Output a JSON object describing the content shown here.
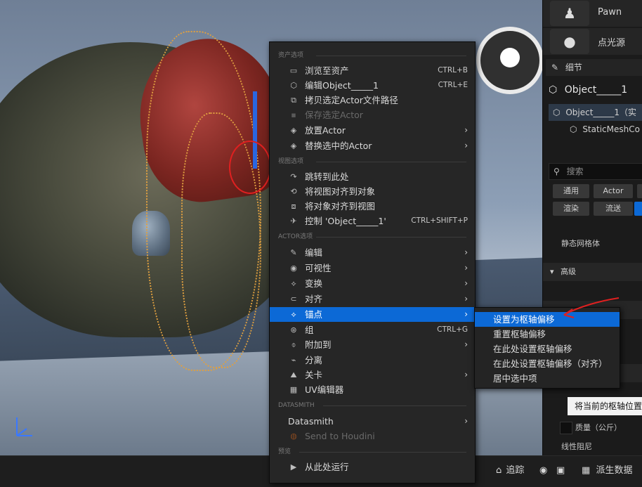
{
  "right_panel": {
    "place_items": [
      {
        "label": "Pawn",
        "icon": "pawn-icon"
      },
      {
        "label": "点光源",
        "icon": "point-light-icon"
      }
    ],
    "details_tab": "细节",
    "object_title": "Object_____1",
    "tree": [
      {
        "label": "Object_____1（实",
        "icon": "cube-icon"
      },
      {
        "label": "StaticMeshCo",
        "icon": "cube-icon"
      }
    ],
    "search_placeholder": "搜索",
    "filters_row1": [
      "通用",
      "Actor"
    ],
    "filters_row2": [
      "渲染",
      "流送"
    ],
    "static_mesh_label": "静态网格体",
    "advanced_label": "高级",
    "mass_label": "质量（公斤）",
    "linear_damping_label": "线性阻尼",
    "tooltip": "将当前的枢轴位置"
  },
  "bottom_bar": {
    "trace_label": "追踪",
    "derived_data_label": "派生数据"
  },
  "menu": {
    "sections": {
      "assets": "资产选项",
      "view": "视图选项",
      "actor": "ACTOR选项",
      "datasmith": "DATASMITH",
      "preview": "预览"
    },
    "items": {
      "browse": {
        "label": "浏览至资产",
        "shortcut": "CTRL+B"
      },
      "edit_object": {
        "label": "编辑Object_____1",
        "shortcut": "CTRL+E"
      },
      "copy_path": {
        "label": "拷贝选定Actor文件路径"
      },
      "save_actor": {
        "label": "保存选定Actor"
      },
      "place_actor": {
        "label": "放置Actor"
      },
      "replace_actor": {
        "label": "替换选中的Actor"
      },
      "jump_here": {
        "label": "跳转到此处"
      },
      "align_view_to_object": {
        "label": "将视图对齐到对象"
      },
      "align_object_to_view": {
        "label": "将对象对齐到视图"
      },
      "control": {
        "label": "控制 'Object_____1'",
        "shortcut": "CTRL+SHIFT+P"
      },
      "edit": {
        "label": "编辑"
      },
      "visibility": {
        "label": "可视性"
      },
      "transform": {
        "label": "变换"
      },
      "align": {
        "label": "对齐"
      },
      "pivot": {
        "label": "锚点"
      },
      "group": {
        "label": "组",
        "shortcut": "CTRL+G"
      },
      "attach_to": {
        "label": "附加到"
      },
      "detach": {
        "label": "分离"
      },
      "level": {
        "label": "关卡"
      },
      "uv_editor": {
        "label": "UV编辑器"
      },
      "datasmith": {
        "label": "Datasmith"
      },
      "send_houdini": {
        "label": "Send to Houdini"
      },
      "run_from_here": {
        "label": "从此处运行"
      }
    }
  },
  "submenu": {
    "items": [
      "设置为枢轴偏移",
      "重置枢轴偏移",
      "在此处设置枢轴偏移",
      "在此处设置枢轴偏移（对齐）",
      "居中选中项"
    ]
  },
  "colors": {
    "highlight": "#0c69d6",
    "menu_bg": "#262626",
    "annotation": "#e02020"
  }
}
